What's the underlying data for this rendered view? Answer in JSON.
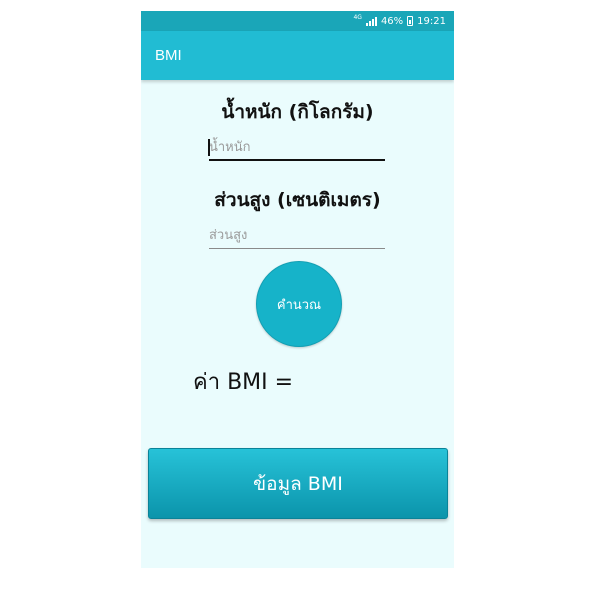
{
  "status_bar": {
    "network": "4G",
    "battery": "46%",
    "time": "19:21"
  },
  "app_bar": {
    "title": "BMI"
  },
  "form": {
    "weight_label": "น้ำหนัก (กิโลกรัม)",
    "weight_placeholder": "น้ำหนัก",
    "height_label": "ส่วนสูง (เซนติเมตร)",
    "height_placeholder": "ส่วนสูง"
  },
  "calculate_button": {
    "label": "คำนวณ"
  },
  "result": {
    "label": "ค่า BMI ="
  },
  "info_button": {
    "label": "ข้อมูล BMI"
  },
  "colors": {
    "status_bar": "#1aa6b8",
    "app_bar": "#21bcd3",
    "background": "#eafcfd",
    "accent": "#16b3c9"
  },
  "icons": [
    "signal-icon",
    "battery-icon"
  ]
}
